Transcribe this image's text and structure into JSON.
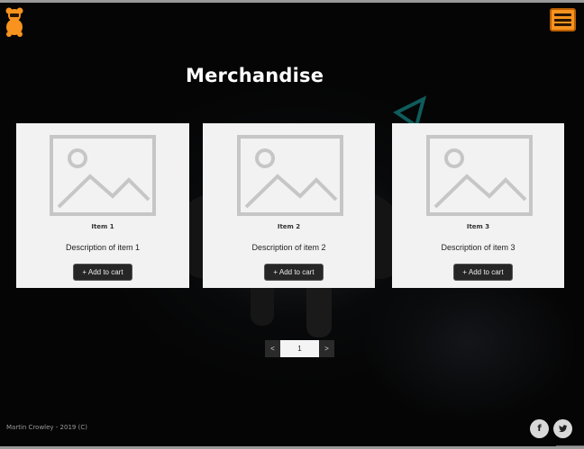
{
  "page": {
    "title": "Merchandise"
  },
  "header": {
    "logo_icon": "teddy-bear-logo-icon",
    "menu_icon": "hamburger-menu-icon"
  },
  "items": [
    {
      "name": "Item 1",
      "description": "Description of item 1",
      "add_label": "+ Add to cart",
      "image_icon": "image-placeholder-icon"
    },
    {
      "name": "Item 2",
      "description": "Description of item 2",
      "add_label": "+ Add to cart",
      "image_icon": "image-placeholder-icon"
    },
    {
      "name": "Item 3",
      "description": "Description of item 3",
      "add_label": "+ Add to cart",
      "image_icon": "image-placeholder-icon"
    }
  ],
  "pagination": {
    "prev_label": "<",
    "current_page": "1",
    "next_label": ">"
  },
  "footer": {
    "copyright": "Martin Crowley - 2019 (C)",
    "facebook_label": "f",
    "twitter_icon": "twitter-bird-icon"
  },
  "colors": {
    "accent": "#f7931e",
    "background": "#050505",
    "card": "#f2f2f2",
    "button": "#262626"
  }
}
